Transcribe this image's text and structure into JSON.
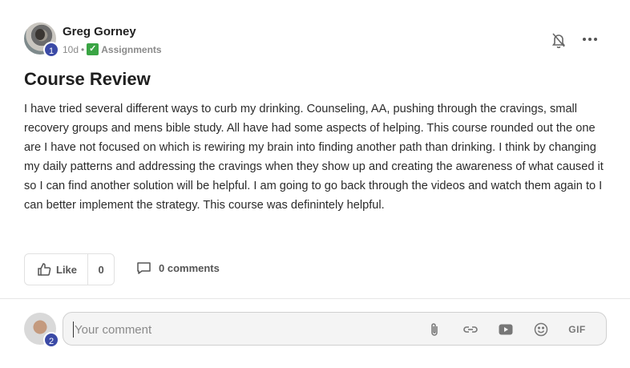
{
  "post": {
    "author": "Greg Gorney",
    "author_level": "1",
    "time_ago": "10d",
    "separator": "•",
    "category_emoji": "✓",
    "category": "Assignments",
    "title": "Course Review",
    "body": "I have tried several different ways to curb my drinking. Counseling, AA, pushing through the cravings, small recovery groups and mens bible study. All have had some aspects of helping. This course rounded out the one are I have not focused on which is rewiring my brain into finding another path than drinking. I think by changing my daily patterns and addressing the cravings when they show up and creating the awareness of what caused it so I can find another solution will be helpful. I am going to go back through the videos and watch them again to I can better implement the strategy. This course was definintely helpful."
  },
  "actions": {
    "like_label": "Like",
    "like_count": "0",
    "comments_label": "0 comments"
  },
  "composer": {
    "user_level": "2",
    "placeholder": "Your comment",
    "gif_label": "GIF"
  },
  "icons": {
    "bell": "bell-off-icon",
    "more": "more-horizontal-icon",
    "like": "thumbs-up-icon",
    "comment": "comment-bubble-icon",
    "attach": "paperclip-icon",
    "link": "link-icon",
    "video": "video-play-icon",
    "emoji": "smiley-icon"
  },
  "colors": {
    "level_badge": "#3b4aa6",
    "category_check": "#3aa544"
  }
}
